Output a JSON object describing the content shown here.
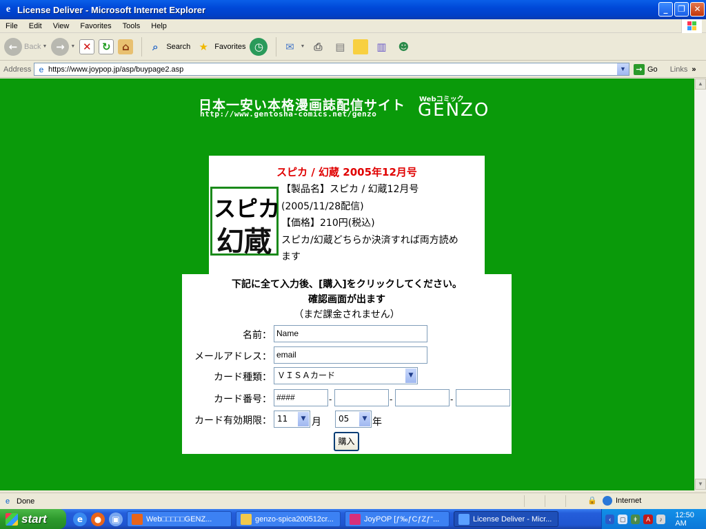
{
  "window": {
    "title": "License Deliver - Microsoft Internet Explorer",
    "minimize": "_",
    "maximize": "❐",
    "close": "✕"
  },
  "menu": [
    "File",
    "Edit",
    "View",
    "Favorites",
    "Tools",
    "Help"
  ],
  "toolbar": {
    "back": "Back",
    "search": "Search",
    "favorites": "Favorites"
  },
  "address": {
    "label": "Address",
    "url": "https://www.joypop.jp/asp/buypage2.asp",
    "go": "Go",
    "links": "Links"
  },
  "page": {
    "banner": {
      "tagline": "日本一安い本格漫画誌配信サイト",
      "url": "http://www.gentosha-comics.net/genzo",
      "webcomic": "Webコミック",
      "logo": "GENZO"
    },
    "product": {
      "title": "スピカ / 幻蔵 2005年12月号",
      "cover_text_top": "スピカ",
      "cover_text_bottom": "幻蔵",
      "lines": [
        "【製品名】スピカ / 幻蔵12月号",
        "(2005/11/28配信)",
        "【価格】210円(税込)",
        "スピカ/幻蔵どちらか決済すれば両方読め",
        "ます"
      ]
    },
    "form": {
      "instruction1": "下記に全て入力後、[購入]をクリックしてください。",
      "instruction2": "確認画面が出ます",
      "instruction3": "（まだ課金されません）",
      "name_label": "名前：",
      "name_value": "Name",
      "email_label": "メールアドレス：",
      "email_value": "email",
      "cardtype_label": "カード種類：",
      "cardtype_value": "ＶＩＳＡカード",
      "cardnum_label": "カード番号：",
      "cardnum": [
        "####",
        "",
        "",
        ""
      ],
      "dash": "-",
      "expiry_label": "カード有効期限：",
      "month_value": "11",
      "month_unit": "月",
      "year_value": "05",
      "year_unit": "年",
      "buy_button": "購入"
    }
  },
  "status": {
    "text": "Done",
    "zone": "Internet"
  },
  "taskbar": {
    "start": "start",
    "tasks": [
      {
        "label": "Web□□□□□GENZ...",
        "icon": "firefox-icon",
        "color": "#e8641a",
        "active": false
      },
      {
        "label": "genzo-spica200512cr...",
        "icon": "folder-icon",
        "color": "#f2c94c",
        "active": false
      },
      {
        "label": "JoyPOP [ƒ‰ƒCƒZƒ“...",
        "icon": "joypop-icon",
        "color": "#d8307a",
        "active": false
      },
      {
        "label": "License Deliver - Micr...",
        "icon": "ie-icon",
        "color": "#5aa0ff",
        "active": true
      }
    ],
    "clock": "12:50 AM"
  }
}
